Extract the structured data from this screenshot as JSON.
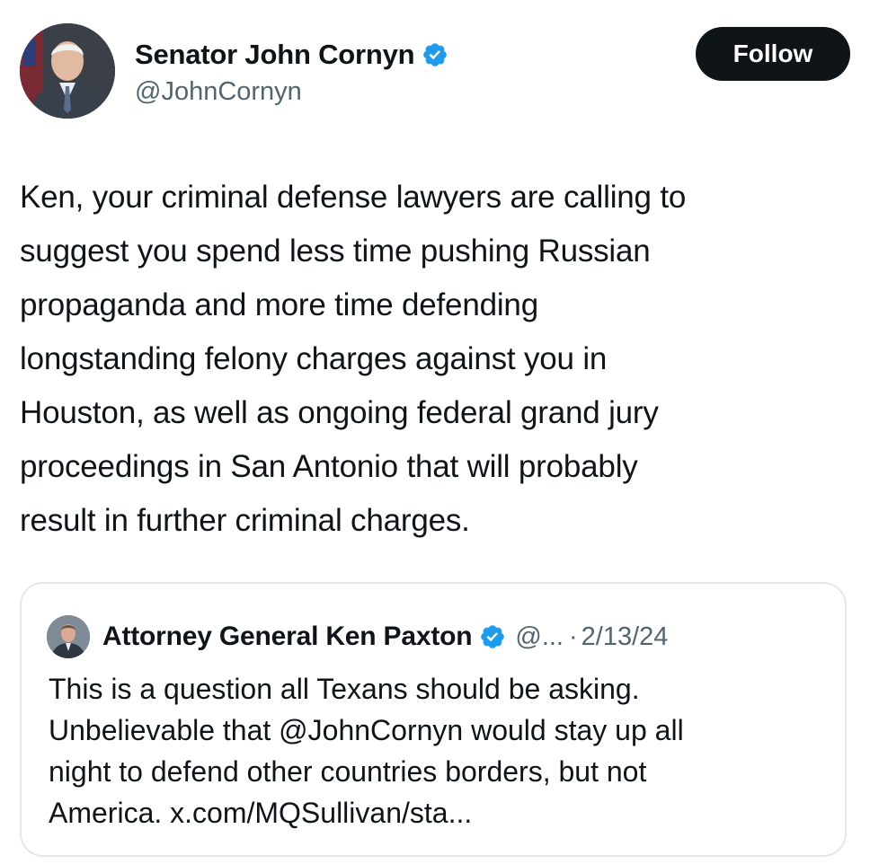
{
  "author": {
    "display_name": "Senator John Cornyn",
    "handle": "@JohnCornyn",
    "verified_icon": "verified-badge-icon"
  },
  "actions": {
    "follow_label": "Follow"
  },
  "tweet": {
    "text": "Ken, your criminal defense lawyers are calling to\nsuggest you spend less time pushing Russian\npropaganda and more time defending\nlongstanding felony charges against you in\nHouston, as well as ongoing federal grand jury\nproceedings in San Antonio that will probably\nresult in further criminal charges."
  },
  "quoted_tweet": {
    "display_name": "Attorney General Ken Paxton",
    "handle": "@...",
    "separator": "·",
    "date": "2/13/24",
    "text": "This is a question all Texans should be asking.\nUnbelievable that @JohnCornyn would stay up all\nnight to defend other countries borders, but not\nAmerica. x.com/MQSullivan/sta..."
  },
  "colors": {
    "verified_blue": "#1d9bf0",
    "text_primary": "#0f1419",
    "text_secondary": "#536471",
    "follow_button_bg": "#0f1419",
    "card_border": "#e3e7ea"
  }
}
